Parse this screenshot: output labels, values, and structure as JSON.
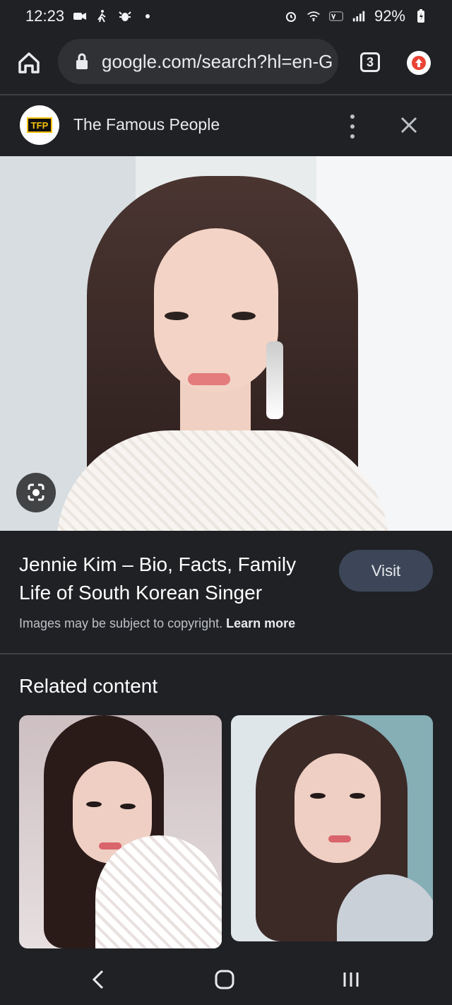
{
  "status": {
    "time": "12:23",
    "battery": "92%",
    "icons": [
      "video-icon",
      "walk-icon",
      "bug-icon",
      "dot-icon",
      "alarm-icon",
      "wifi-icon",
      "volte-icon",
      "signal-icon",
      "battery-charging-icon"
    ]
  },
  "browser": {
    "url": "google.com/search?hl=en-G",
    "tab_count": "3",
    "icons": [
      "home-icon",
      "lock-icon",
      "tabs-icon",
      "update-icon"
    ]
  },
  "source": {
    "logo_text": "TFP",
    "name": "The Famous People",
    "icons": [
      "more-vert-icon",
      "close-icon"
    ]
  },
  "result": {
    "title": "Jennie Kim – Bio, Facts, Family Life of South Korean Singer",
    "visit_label": "Visit",
    "copyright_text": "Images may be subject to copyright.",
    "learn_more": "Learn more",
    "icons": [
      "lens-icon"
    ]
  },
  "related": {
    "heading": "Related content"
  },
  "navigation": {
    "icons": [
      "back-icon",
      "home-nav-icon",
      "recents-icon"
    ]
  },
  "colors": {
    "background": "#202124",
    "surface": "#303134",
    "visit_button": "#3c4658",
    "update_icon": "#ea4335"
  }
}
